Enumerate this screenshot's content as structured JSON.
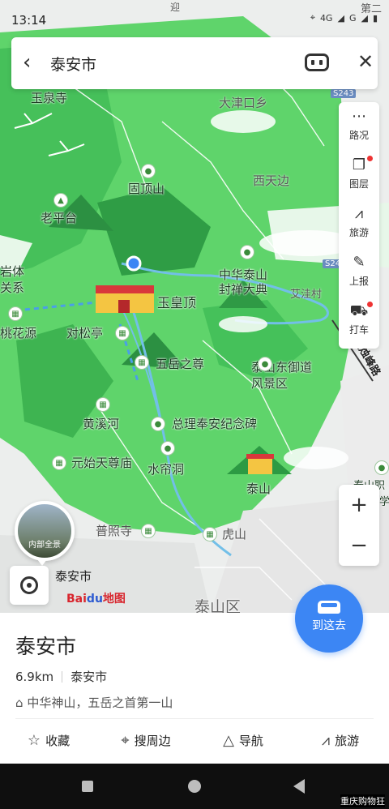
{
  "status": {
    "time": "13:14",
    "net1": "4G",
    "net2": "G"
  },
  "search": {
    "query": "泰安市"
  },
  "toolbar": {
    "items": [
      {
        "label": "路况",
        "icon": "traffic-icon"
      },
      {
        "label": "图层",
        "icon": "layers-icon"
      },
      {
        "label": "旅游",
        "icon": "travel-icon"
      },
      {
        "label": "上报",
        "icon": "report-icon"
      },
      {
        "label": "打车",
        "icon": "taxi-icon"
      }
    ]
  },
  "map": {
    "labels": [
      "玉泉寺",
      "大津口乡",
      "固顶山",
      "西天边",
      "老平台",
      "中华泰山",
      "封禅大典",
      "艾洼村",
      "岩体",
      "关系",
      "桃花源",
      "玉皇顶",
      "对松亭",
      "五岳之尊",
      "泰山东御道",
      "风景区",
      "黄溪河",
      "总理奉安纪念碑",
      "元始天尊庙",
      "水帘洞",
      "泰山",
      "普照寺",
      "虎山",
      "泰山区",
      "天烛峰路",
      "S243",
      "S24",
      "泰山职",
      "学",
      "第二",
      "迎"
    ],
    "panorama": "内部全景",
    "city_name": "泰安市",
    "logo": {
      "a": "Bai",
      "b": "du",
      "c": "地图"
    }
  },
  "zoom": {
    "in": "+",
    "out": "−"
  },
  "goto": {
    "label": "到这去"
  },
  "place": {
    "name": "泰安市",
    "distance": "6.9km",
    "region": "泰安市",
    "tag": "中华神山，五岳之首第一山"
  },
  "actions": [
    {
      "label": "收藏",
      "icon": "star-icon"
    },
    {
      "label": "搜周边",
      "icon": "location-pin-icon"
    },
    {
      "label": "导航",
      "icon": "navigate-icon"
    },
    {
      "label": "旅游",
      "icon": "travel-icon"
    }
  ],
  "watermark": "重庆购物狂"
}
